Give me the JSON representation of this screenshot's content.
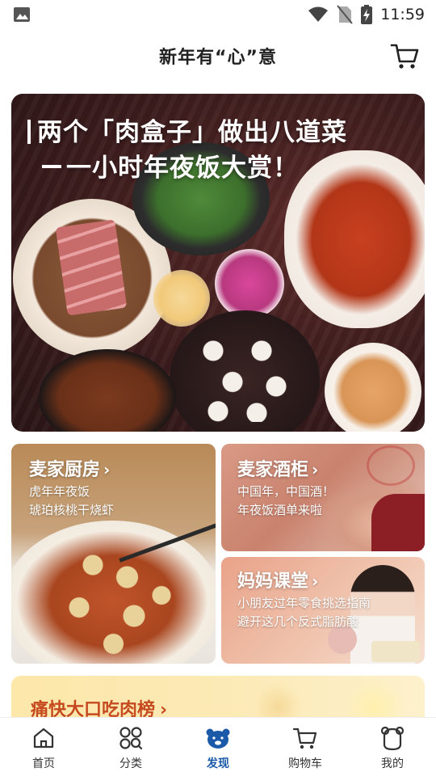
{
  "status_bar": {
    "time": "11:59",
    "icons": [
      "image-icon",
      "wifi-icon",
      "no-sim-icon",
      "battery-charging-icon"
    ]
  },
  "header": {
    "title": "新年有“心”意",
    "cart_icon": "shopping-cart-icon"
  },
  "hero": {
    "title_line1": "两个「肉盒子」做出八道菜",
    "title_line2": "一小时年夜饭大赏！"
  },
  "cards": {
    "kitchen": {
      "title": "麦家厨房",
      "sub1": "虎年年夜饭",
      "sub2": "琥珀核桃干烧虾"
    },
    "wine": {
      "title": "麦家酒柜",
      "sub1": "中国年，中国酒！",
      "sub2": "年夜饭酒单来啦"
    },
    "mom": {
      "title": "妈妈课堂",
      "sub1": "小朋友过年零食挑选指南",
      "sub2": "避开这几个反式脂肪酸"
    }
  },
  "meat_list": {
    "title": "痛快大口吃肉榜"
  },
  "tabbar": {
    "tabs": [
      {
        "label": "首页",
        "icon": "home-icon"
      },
      {
        "label": "分类",
        "icon": "category-icon"
      },
      {
        "label": "发现",
        "icon": "bear-icon"
      },
      {
        "label": "购物车",
        "icon": "cart-icon"
      },
      {
        "label": "我的",
        "icon": "profile-icon"
      }
    ],
    "active_index": 2,
    "active_color": "#1b5aa8"
  }
}
